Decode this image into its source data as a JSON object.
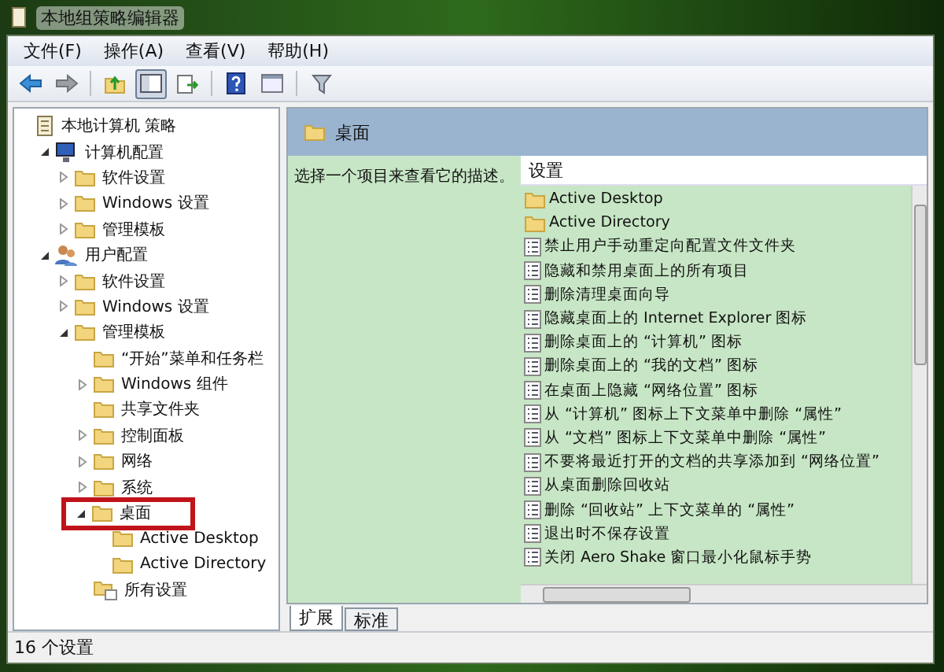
{
  "window": {
    "title": "本地组策略编辑器"
  },
  "menu": [
    "文件(F)",
    "操作(A)",
    "查看(V)",
    "帮助(H)"
  ],
  "toolbar": [
    {
      "kind": "back",
      "pressed": false
    },
    {
      "kind": "forward",
      "pressed": false
    },
    {
      "kind": "up",
      "pressed": false
    },
    {
      "kind": "tree",
      "pressed": true
    },
    {
      "kind": "export",
      "pressed": false
    },
    {
      "kind": "help",
      "pressed": false
    },
    {
      "kind": "properties",
      "pressed": false
    },
    {
      "kind": "filter",
      "pressed": false
    }
  ],
  "tree": [
    {
      "label": "本地计算机 策略",
      "kind": "policy",
      "children": [
        {
          "label": "计算机配置",
          "kind": "computer",
          "expanded": true,
          "children": [
            {
              "label": "软件设置",
              "kind": "folder",
              "expanded": false
            },
            {
              "label": "Windows 设置",
              "kind": "folder",
              "expanded": false
            },
            {
              "label": "管理模板",
              "kind": "folder",
              "expanded": false
            }
          ]
        },
        {
          "label": "用户配置",
          "kind": "user",
          "expanded": true,
          "children": [
            {
              "label": "软件设置",
              "kind": "folder",
              "expanded": false
            },
            {
              "label": "Windows 设置",
              "kind": "folder",
              "expanded": false
            },
            {
              "label": "管理模板",
              "kind": "folder",
              "expanded": true,
              "children": [
                {
                  "label": "“开始”菜单和任务栏",
                  "kind": "folder"
                },
                {
                  "label": "Windows 组件",
                  "kind": "folder",
                  "expanded": false
                },
                {
                  "label": "共享文件夹",
                  "kind": "folder"
                },
                {
                  "label": "控制面板",
                  "kind": "folder",
                  "expanded": false
                },
                {
                  "label": "网络",
                  "kind": "folder",
                  "expanded": false
                },
                {
                  "label": "系统",
                  "kind": "folder",
                  "expanded": false
                },
                {
                  "label": "桌面",
                  "kind": "folder",
                  "expanded": true,
                  "annotated": true,
                  "children": [
                    {
                      "label": "Active Desktop",
                      "kind": "folder"
                    },
                    {
                      "label": "Active Directory",
                      "kind": "folder"
                    }
                  ]
                },
                {
                  "label": "所有设置",
                  "kind": "settings"
                }
              ]
            }
          ]
        }
      ]
    }
  ],
  "detail": {
    "title": "桌面",
    "description": "选择一个项目来查看它的描述。",
    "column": "设置",
    "items": [
      {
        "label": "Active Desktop",
        "kind": "folder"
      },
      {
        "label": "Active Directory",
        "kind": "folder"
      },
      {
        "label": "禁止用户手动重定向配置文件文件夹",
        "kind": "policy"
      },
      {
        "label": "隐藏和禁用桌面上的所有项目",
        "kind": "policy"
      },
      {
        "label": "删除清理桌面向导",
        "kind": "policy"
      },
      {
        "label": "隐藏桌面上的 Internet Explorer 图标",
        "kind": "policy"
      },
      {
        "label": "删除桌面上的 “计算机” 图标",
        "kind": "policy"
      },
      {
        "label": "删除桌面上的 “我的文档” 图标",
        "kind": "policy"
      },
      {
        "label": "在桌面上隐藏 “网络位置” 图标",
        "kind": "policy"
      },
      {
        "label": "从 “计算机” 图标上下文菜单中删除 “属性”",
        "kind": "policy"
      },
      {
        "label": "从 “文档” 图标上下文菜单中删除 “属性”",
        "kind": "policy"
      },
      {
        "label": "不要将最近打开的文档的共享添加到 “网络位置”",
        "kind": "policy"
      },
      {
        "label": "从桌面删除回收站",
        "kind": "policy"
      },
      {
        "label": "删除 “回收站” 上下文菜单的 “属性”",
        "kind": "policy"
      },
      {
        "label": "退出时不保存设置",
        "kind": "policy"
      },
      {
        "label": "关闭 Aero Shake 窗口最小化鼠标手势",
        "kind": "policy"
      }
    ]
  },
  "tabs": [
    {
      "label": "扩展",
      "selected": true
    },
    {
      "label": "标准",
      "selected": false
    }
  ],
  "status_bar": "16 个设置"
}
